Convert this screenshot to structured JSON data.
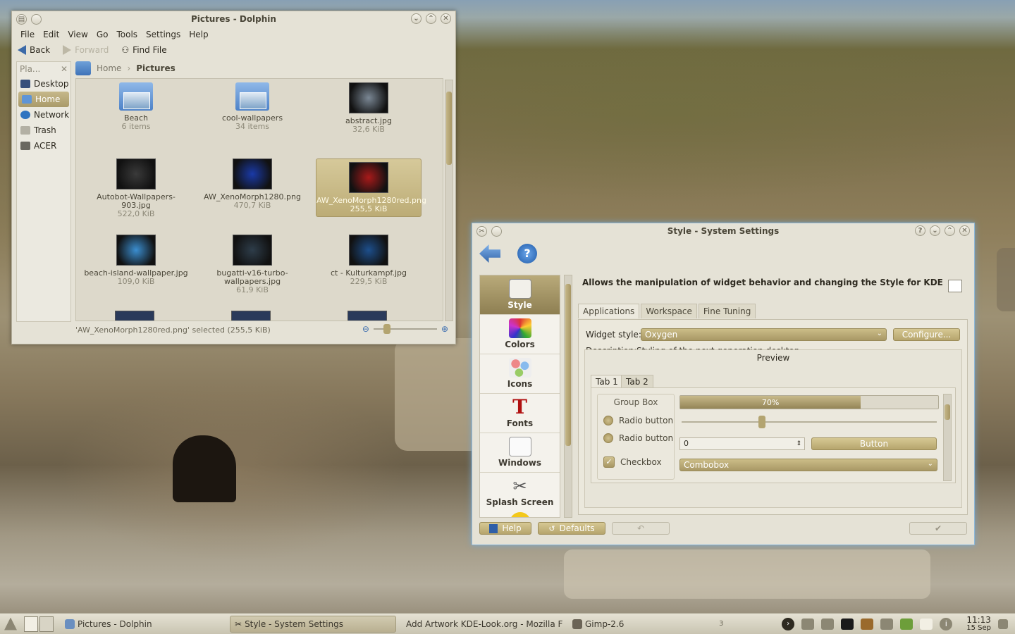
{
  "dolphin": {
    "title": "Pictures - Dolphin",
    "menu": [
      "File",
      "Edit",
      "View",
      "Go",
      "Tools",
      "Settings",
      "Help"
    ],
    "toolbar": {
      "back": "Back",
      "forward": "Forward",
      "find": "Find File"
    },
    "places_header": "Pla...",
    "places": [
      "Desktop",
      "Home",
      "Network",
      "Trash",
      "ACER"
    ],
    "breadcrumb": {
      "home": "Home",
      "current": "Pictures"
    },
    "items": [
      {
        "name": "Beach",
        "size": "6 items",
        "folder": true,
        "color": "#4d82c8"
      },
      {
        "name": "cool-wallpapers",
        "size": "34 items",
        "folder": true,
        "color": "#4d82c8"
      },
      {
        "name": "abstract.jpg",
        "size": "32,6 KiB",
        "color": "#7a8794"
      },
      {
        "name": "Autobot-Wallpapers-903.jpg",
        "size": "522,0 KiB",
        "color": "#3a3a3a"
      },
      {
        "name": "AW_XenoMorph1280.png",
        "size": "470,7 KiB",
        "color": "#1a3aa8"
      },
      {
        "name": "AW_XenoMorph1280red.png",
        "size": "255,5 KiB",
        "color": "#a81a1a"
      },
      {
        "name": "beach-island-wallpaper.jpg",
        "size": "109,0 KiB",
        "color": "#3b8ed0"
      },
      {
        "name": "bugatti-v16-turbo-wallpapers.jpg",
        "size": "61,9 KiB",
        "color": "#2e3d4a"
      },
      {
        "name": "ct -  Kulturkampf.jpg",
        "size": "229,5 KiB",
        "color": "#1d4f8c"
      }
    ],
    "status": "'AW_XenoMorph1280red.png' selected (255,5 KiB)"
  },
  "settings": {
    "title": "Style - System Settings",
    "categories": [
      "Style",
      "Colors",
      "Icons",
      "Fonts",
      "Windows",
      "Splash Screen"
    ],
    "headline": "Allows the manipulation of widget behavior and changing the Style for KDE",
    "tabs": [
      "Applications",
      "Workspace",
      "Fine Tuning"
    ],
    "widget_style_label": "Widget style:",
    "widget_style_value": "Oxygen",
    "configure": "Configure...",
    "description_label": "Description:",
    "description": "Styling of the next generation desktop",
    "preview_label": "Preview",
    "preview_tabs": [
      "Tab 1",
      "Tab 2"
    ],
    "group_box": "Group Box",
    "radio1": "Radio button",
    "radio2": "Radio button",
    "checkbox": "Checkbox",
    "progress": 70,
    "progress_label": "70%",
    "slider": 0.3,
    "spin_value": "0",
    "button": "Button",
    "combobox": "Combobox",
    "help": "Help",
    "defaults": "Defaults"
  },
  "taskbar": {
    "tasks": [
      "Pictures - Dolphin",
      "Style - System Settings",
      "Add  Artwork KDE-Look.org - Mozilla F",
      "Gimp-2.6"
    ],
    "time": "11:13",
    "date": "15 Sep",
    "page_num": "3"
  }
}
